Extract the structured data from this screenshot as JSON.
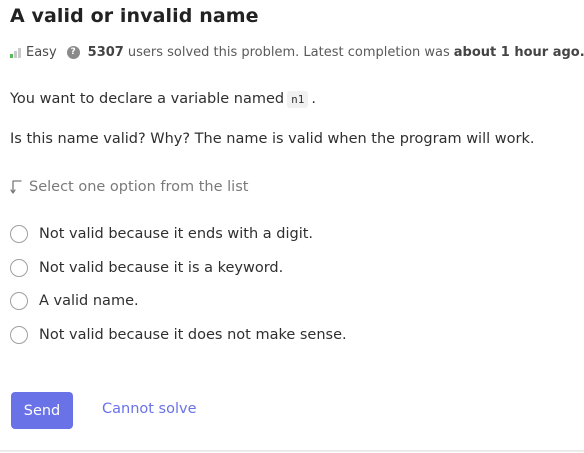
{
  "problem": {
    "title": "A valid or invalid name",
    "difficulty": "Easy",
    "solved_count": "5307",
    "solved_text": "users solved this problem. Latest completion was",
    "latest_completion": "about 1 hour ago.",
    "help_icon_glyph": "?"
  },
  "content": {
    "line1_prefix": "You want to declare a variable named",
    "line1_code": "n1",
    "line1_suffix": ".",
    "line2": "Is this name valid? Why? The name is valid when the program will work."
  },
  "quiz": {
    "instruction": "Select one option from the list",
    "options": [
      "Not valid because it ends with a digit.",
      "Not valid because it is a keyword.",
      "A valid name.",
      "Not valid because it does not make sense."
    ]
  },
  "actions": {
    "send_label": "Send",
    "cannot_solve_label": "Cannot solve"
  },
  "colors": {
    "accent": "#6a72e8",
    "difficulty_bar": "#5cb85c"
  }
}
